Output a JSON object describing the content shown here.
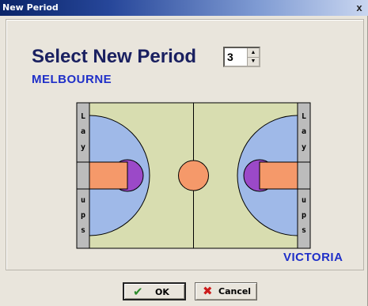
{
  "window": {
    "title": "New Period",
    "close_glyph": "x"
  },
  "dialog": {
    "heading": "Select New Period",
    "period_value": "3",
    "home_team": "MELBOURNE",
    "away_team": "VICTORIA"
  },
  "court": {
    "left_layups": [
      "L",
      "a",
      "y",
      "u",
      "p",
      "s"
    ],
    "right_layups": [
      "L",
      "a",
      "y",
      "u",
      "p",
      "s"
    ],
    "colors": {
      "floor": "#d8ddb0",
      "three_point_area": "#9fb9e8",
      "key": "#f5996a",
      "semicircle": "#9b49c8",
      "center_circle": "#f5996a",
      "layup_bar": "#bcbcbc"
    }
  },
  "buttons": {
    "ok_label": "OK",
    "cancel_label": "Cancel",
    "ok_icon": "check-icon",
    "cancel_icon": "x-icon"
  }
}
